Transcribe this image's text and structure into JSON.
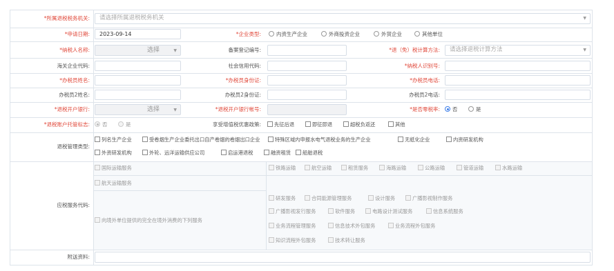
{
  "rows": {
    "tax_authority": {
      "label": "*所属退税税务机关:",
      "placeholder": "请选择所属退税税务机关"
    },
    "apply_date": {
      "label": "*申请日期:",
      "value": "2023-09-14"
    },
    "enterprise_type": {
      "label": "*企业类型:",
      "options": [
        "内资生产企业",
        "外商投资企业",
        "外贸企业",
        "其他单位"
      ]
    },
    "taxpayer_name": {
      "label": "*纳税人名称:",
      "select_label": "选择"
    },
    "record_no": {
      "label": "备案登记编号:"
    },
    "refund_method": {
      "label": "*退（免）税计算方法:",
      "placeholder": "请选择退税计算方法"
    },
    "customs_code": {
      "label": "海关企业代码:"
    },
    "credit_code": {
      "label": "社会信用代码:"
    },
    "taxpayer_id": {
      "label": "*纳税人识别号:"
    },
    "handler_name": {
      "label": "*办税员姓名:"
    },
    "handler_id": {
      "label": "*办税员身份证:"
    },
    "handler_phone": {
      "label": "*办税员电话:"
    },
    "handler2_name": {
      "label": "办税员2姓名:"
    },
    "handler2_id": {
      "label": "办税员2身份证:"
    },
    "handler2_phone": {
      "label": "办税员2电话:"
    },
    "refund_bank": {
      "label": "*退税开户银行:",
      "select_label": "选择"
    },
    "refund_account": {
      "label": "*退税开户银行帐号:"
    },
    "zero_rate": {
      "label": "*是否零税率:",
      "options": [
        "否",
        "是"
      ]
    },
    "trustee_flag": {
      "label": "*退税账户托管标志:",
      "options": [
        "否",
        "是"
      ]
    },
    "vat_policy": {
      "label": "享受增值税优惠政策:",
      "options": [
        "先征后退",
        "即征即退",
        "超税负返还",
        "其他"
      ]
    },
    "mgmt_type": {
      "label": "退税管理类型:",
      "line1": [
        "列名生产企业",
        "受卷烟生产企业委托出口自产卷烟的卷烟出口企业",
        "特殊区域内申报水电气退税业务的生产企业",
        "无纸化企业",
        "内资研发机构"
      ],
      "line2": [
        "外资研发机构",
        "外轮、远洋运输供应公司",
        "启运港退税",
        "融资租赁",
        "船舶退税"
      ]
    },
    "service_code": {
      "label": "应税服务代码:",
      "intl_transport": "国际运输服务",
      "transport_types": [
        "铁路运输",
        "航空运输",
        "租赁服务",
        "海路运输",
        "公路运输",
        "管道运输",
        "水路运输"
      ],
      "aerospace": "航天运输服务",
      "overseas": "向境外单位提供的完全在境外消费的下列服务",
      "sub_services": [
        [
          "研发服务",
          "合同能源管理服务",
          "设计服务",
          "广播影视制作服务"
        ],
        [
          "广播影视发行服务",
          "软件服务",
          "电路设计测试服务",
          "信息系统服务"
        ],
        [
          "业务流程管理服务",
          "信息技术外包服务",
          "业务流程外包服务"
        ],
        [
          "知识流程外包服务",
          "技术转让服务"
        ]
      ]
    },
    "attachment": {
      "label": "附送资料:"
    }
  }
}
